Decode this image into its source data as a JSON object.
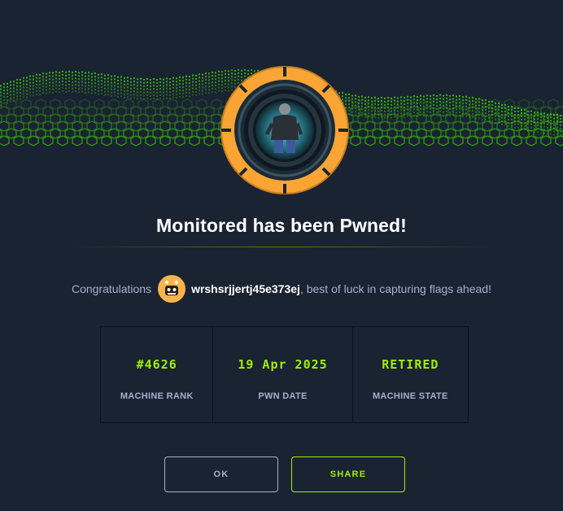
{
  "modal": {
    "title": "Monitored has been Pwned!",
    "congrats_prefix": "Congratulations",
    "username": "wrshsrjjertj45e373ej",
    "congrats_suffix": ", best of luck in capturing flags ahead!"
  },
  "stats": [
    {
      "value": "#4626",
      "label": "MACHINE RANK"
    },
    {
      "value": "19 Apr 2025",
      "label": "PWN DATE"
    },
    {
      "value": "RETIRED",
      "label": "MACHINE STATE"
    }
  ],
  "buttons": {
    "ok_label": "OK",
    "share_label": "SHARE"
  },
  "icons": {
    "banner": "green-hex-wave-banner",
    "machine_badge": "machine-avatar-badge",
    "user_avatar": "user-avatar"
  },
  "colors": {
    "background": "#1a2332",
    "accent": "#9fef00",
    "badge_ring": "#f9a535",
    "muted_text": "#a4b1cd"
  }
}
